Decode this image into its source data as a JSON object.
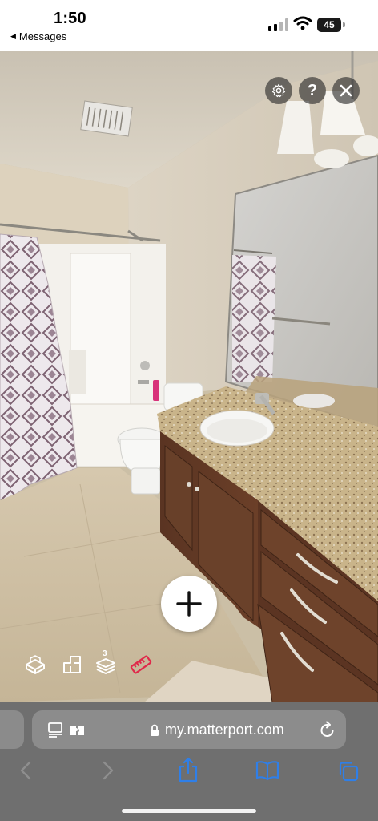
{
  "status_bar": {
    "time": "1:50",
    "back_label": "Messages",
    "battery_level": "45"
  },
  "viewer": {
    "scene": "Bathroom 3D tour view",
    "controls": {
      "settings_icon": "gear-icon",
      "help_label": "?",
      "close_icon": "close-icon",
      "add_icon": "plus-icon"
    },
    "toolbar": {
      "dollhouse_icon": "dollhouse-icon",
      "floorplan_icon": "floorplan-icon",
      "floors_icon": "floors-icon",
      "floors_badge": "3",
      "measure_icon": "ruler-icon",
      "measure_color": "#e0294a"
    }
  },
  "browser": {
    "url": "my.matterport.com",
    "nav_icons": [
      "back-icon",
      "forward-icon",
      "share-icon",
      "bookmarks-icon",
      "tabs-icon"
    ],
    "accent": "#2f7fe8"
  }
}
